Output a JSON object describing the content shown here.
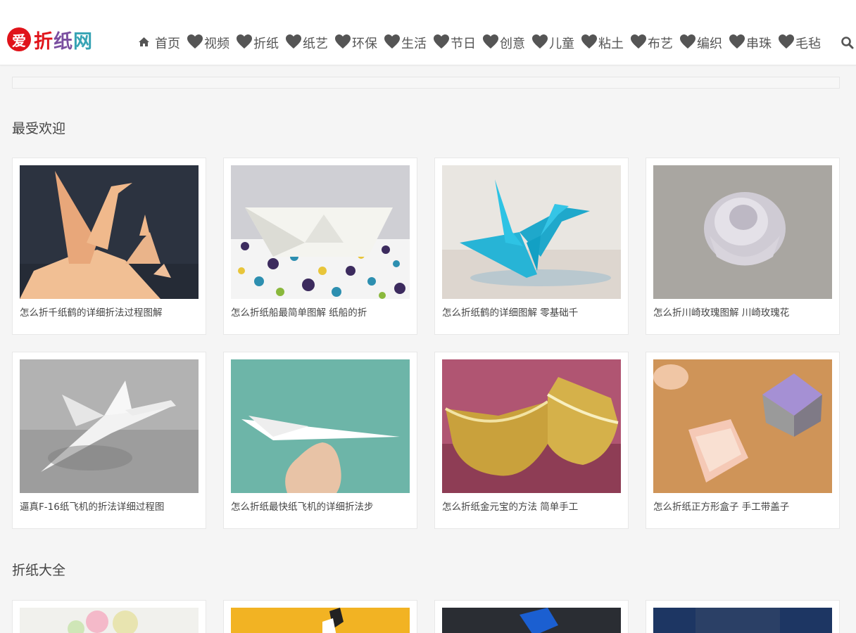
{
  "header": {
    "logo": {
      "badge": "爱",
      "part1": "折",
      "part2": "纸",
      "part3": "网"
    },
    "nav": [
      {
        "label": "首页",
        "icon": "home-icon"
      },
      {
        "label": "视频",
        "icon": "heart-icon"
      },
      {
        "label": "折纸",
        "icon": "heart-icon"
      },
      {
        "label": "纸艺",
        "icon": "heart-icon"
      },
      {
        "label": "环保",
        "icon": "heart-icon"
      },
      {
        "label": "生活",
        "icon": "heart-icon"
      },
      {
        "label": "节日",
        "icon": "heart-icon"
      },
      {
        "label": "创意",
        "icon": "heart-icon"
      },
      {
        "label": "儿童",
        "icon": "heart-icon"
      },
      {
        "label": "粘土",
        "icon": "heart-icon"
      },
      {
        "label": "布艺",
        "icon": "heart-icon"
      },
      {
        "label": "编织",
        "icon": "heart-icon"
      },
      {
        "label": "串珠",
        "icon": "heart-icon"
      },
      {
        "label": "毛毡",
        "icon": "heart-icon"
      }
    ],
    "search_icon": "search-icon"
  },
  "sections": [
    {
      "title": "最受欢迎",
      "cards": [
        {
          "caption": "怎么折千纸鹤的详细折法过程图解",
          "image": "paper-cranes-orange"
        },
        {
          "caption": "怎么折纸船最简单图解 纸船的折",
          "image": "paper-boat-white"
        },
        {
          "caption": "怎么折纸鹤的详细图解 零基础千",
          "image": "paper-crane-blue"
        },
        {
          "caption": "怎么折川崎玫瑰图解 川崎玫瑰花",
          "image": "paper-rose-white"
        },
        {
          "caption": "逼真F-16纸飞机的折法详细过程图",
          "image": "paper-jet-white"
        },
        {
          "caption": "怎么折纸最快纸飞机的详细折法步",
          "image": "paper-plane-hand"
        },
        {
          "caption": "怎么折纸金元宝的方法 简单手工",
          "image": "gold-ingots"
        },
        {
          "caption": "怎么折纸正方形盒子 手工带盖子",
          "image": "paper-boxes"
        }
      ]
    },
    {
      "title": "折纸大全",
      "cards": [
        {
          "caption": "",
          "image": "partial-flowers"
        },
        {
          "caption": "",
          "image": "partial-yellow"
        },
        {
          "caption": "",
          "image": "partial-dark-blue"
        },
        {
          "caption": "",
          "image": "partial-navy"
        }
      ]
    }
  ],
  "colors": {
    "brand_red": "#e0131a",
    "nav_text": "#555555",
    "page_bg": "#f5f5f5"
  }
}
